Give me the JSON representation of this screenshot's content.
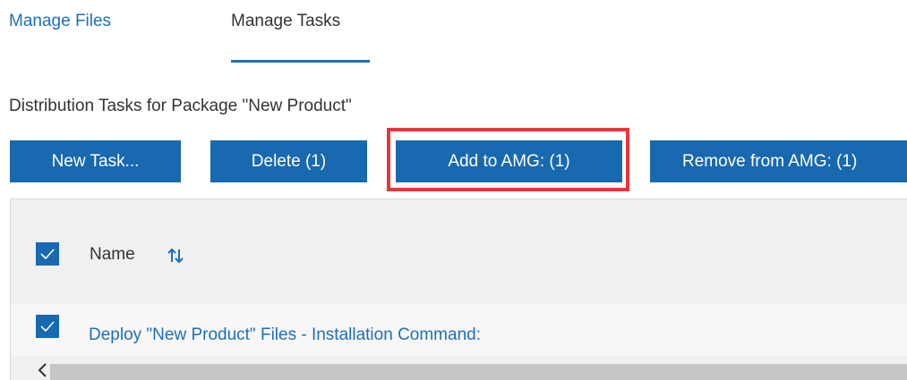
{
  "tabs": {
    "manage_files": "Manage Files",
    "manage_tasks": "Manage Tasks"
  },
  "heading": "Distribution Tasks for Package \"New Product\"",
  "toolbar": {
    "new_task": "New Task...",
    "delete": "Delete (1)",
    "add_to_amg": "Add to AMG: (1)",
    "remove_from_amg": "Remove from AMG: (1)"
  },
  "grid": {
    "column_name": "Name",
    "rows": [
      {
        "name": "Deploy \"New Product\" Files - Installation Command:"
      }
    ]
  },
  "colors": {
    "accent": "#1869b0",
    "link": "#1d6fb8",
    "highlight": "#e8363c"
  }
}
